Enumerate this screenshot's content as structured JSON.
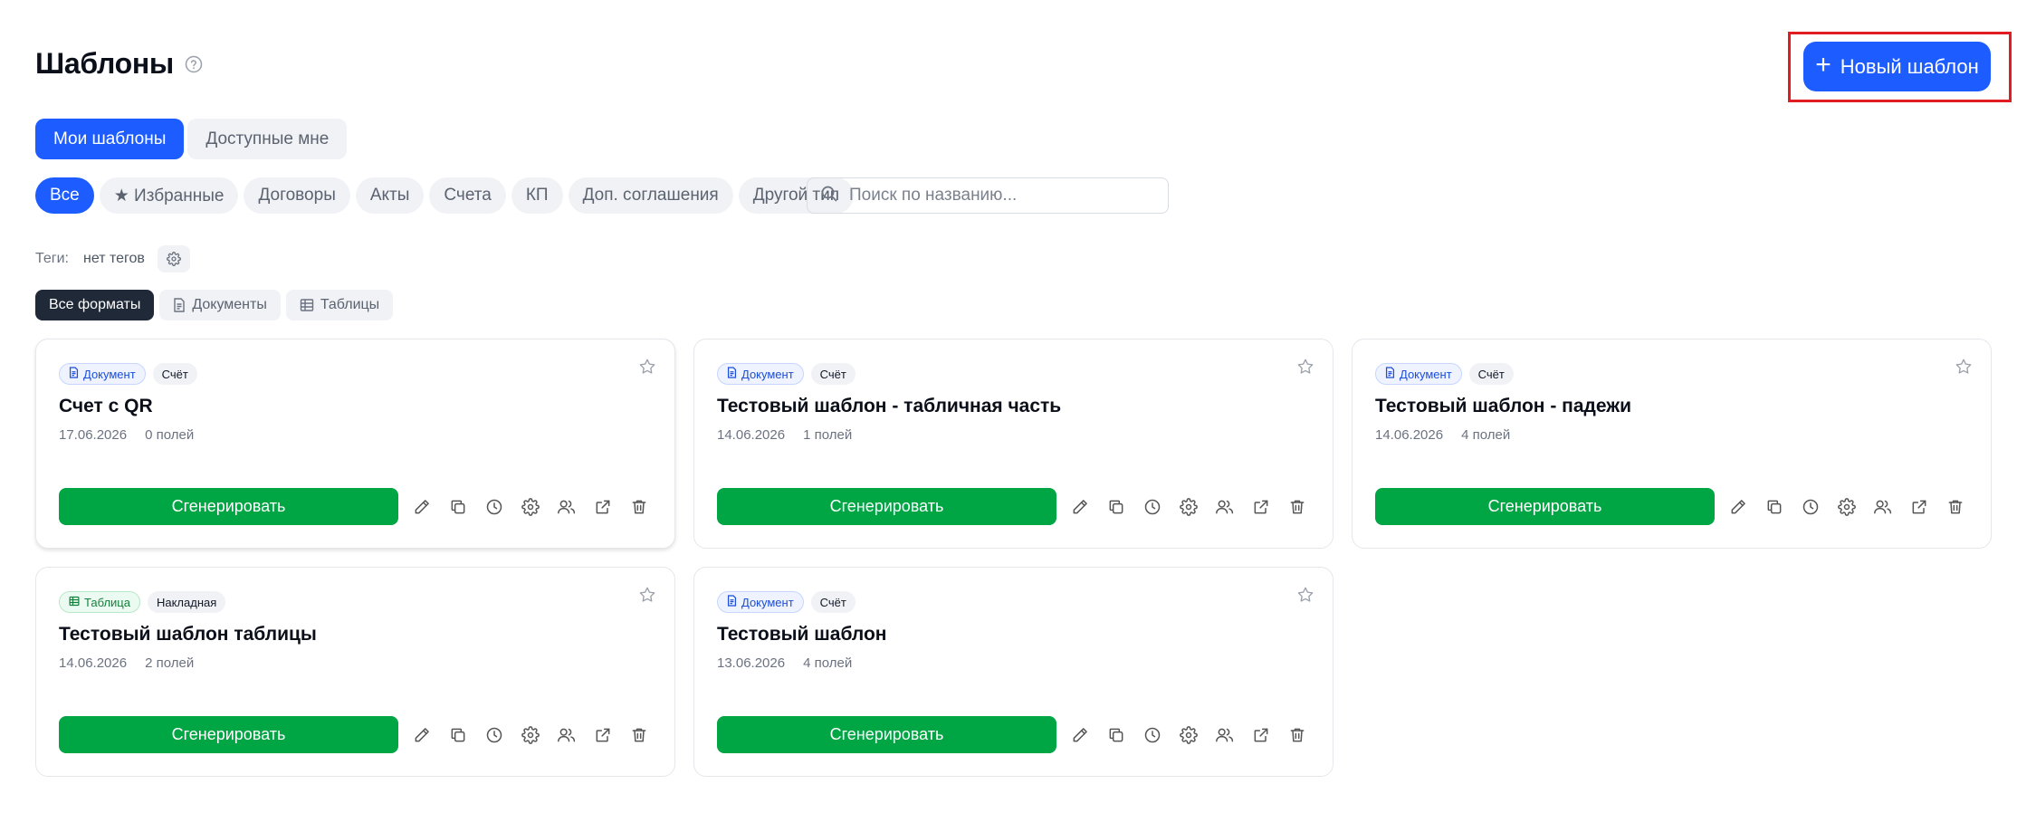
{
  "header": {
    "title": "Шаблоны",
    "new_button_label": "Новый шаблон"
  },
  "tabs": [
    {
      "label": "Мои шаблоны",
      "active": true
    },
    {
      "label": "Доступные мне",
      "active": false
    }
  ],
  "filters": {
    "chips": [
      {
        "label": "Все",
        "active": true
      },
      {
        "label": "★ Избранные",
        "active": false
      },
      {
        "label": "Договоры",
        "active": false
      },
      {
        "label": "Акты",
        "active": false
      },
      {
        "label": "Счета",
        "active": false
      },
      {
        "label": "КП",
        "active": false
      },
      {
        "label": "Доп. соглашения",
        "active": false
      },
      {
        "label": "Другой тип",
        "active": false
      }
    ],
    "search_placeholder": "Поиск по названию..."
  },
  "tags": {
    "label": "Теги:",
    "value": "нет тегов"
  },
  "formats": [
    {
      "label": "Все форматы",
      "active": true
    },
    {
      "label": "Документы",
      "active": false
    },
    {
      "label": "Таблицы",
      "active": false
    }
  ],
  "cards": [
    {
      "format": "Документ",
      "type": "Счёт",
      "title": "Счет с QR",
      "date": "17.06.2026",
      "fields": "0 полей",
      "button": "Сгенерировать"
    },
    {
      "format": "Документ",
      "type": "Счёт",
      "title": "Тестовый шаблон - табличная часть",
      "date": "14.06.2026",
      "fields": "1 полей",
      "button": "Сгенерировать"
    },
    {
      "format": "Документ",
      "type": "Счёт",
      "title": "Тестовый шаблон - падежи",
      "date": "14.06.2026",
      "fields": "4 полей",
      "button": "Сгенерировать"
    },
    {
      "format": "Таблица",
      "type": "Накладная",
      "title": "Тестовый шаблон таблицы",
      "date": "14.06.2026",
      "fields": "2 полей",
      "button": "Сгенерировать"
    },
    {
      "format": "Документ",
      "type": "Счёт",
      "title": "Тестовый шаблон",
      "date": "13.06.2026",
      "fields": "4 полей",
      "button": "Сгенерировать"
    }
  ],
  "colors": {
    "accent": "#1d5cff",
    "success": "#00a544",
    "highlight": "#e11d24"
  }
}
